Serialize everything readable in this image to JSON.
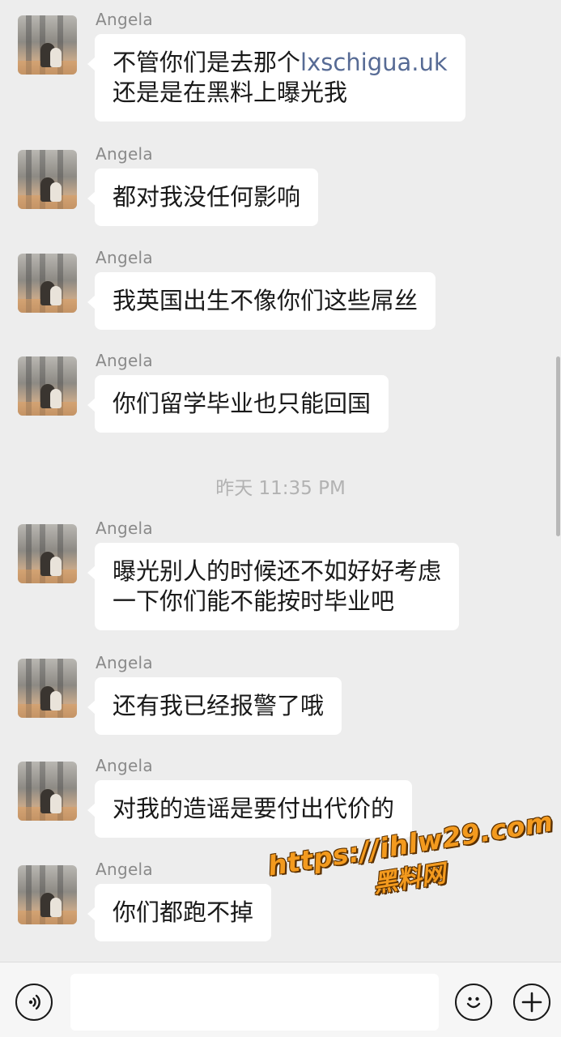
{
  "chat": {
    "messages": [
      {
        "sender": "Angela",
        "text_prefix": "不管你们是去那个",
        "link": "lxschigua.uk",
        "line2": "还是是在黑料上曝光我"
      },
      {
        "sender": "Angela",
        "text": "都对我没任何影响"
      },
      {
        "sender": "Angela",
        "text": "我英国出生不像你们这些屌丝"
      },
      {
        "sender": "Angela",
        "text": "你们留学毕业也只能回国"
      },
      {
        "sender": "Angela",
        "line1": "曝光别人的时候还不如好好考虑",
        "line2": "一下你们能不能按时毕业吧"
      },
      {
        "sender": "Angela",
        "text": "还有我已经报警了哦"
      },
      {
        "sender": "Angela",
        "text": "对我的造谣是要付出代价的"
      },
      {
        "sender": "Angela",
        "text": "你们都跑不掉"
      }
    ],
    "timestamp": "昨天 11:35 PM"
  },
  "watermark": {
    "url": "https://ihlw29.com",
    "name": "黑料网"
  },
  "input_bar": {
    "voice_icon": "voice-icon",
    "emoji_icon": "emoji-icon",
    "plus_icon": "plus-icon",
    "input_value": ""
  },
  "colors": {
    "background": "#ededed",
    "bubble": "#ffffff",
    "link": "#576b95",
    "sender": "#8a8a8a",
    "watermark": "#f39a1e"
  }
}
